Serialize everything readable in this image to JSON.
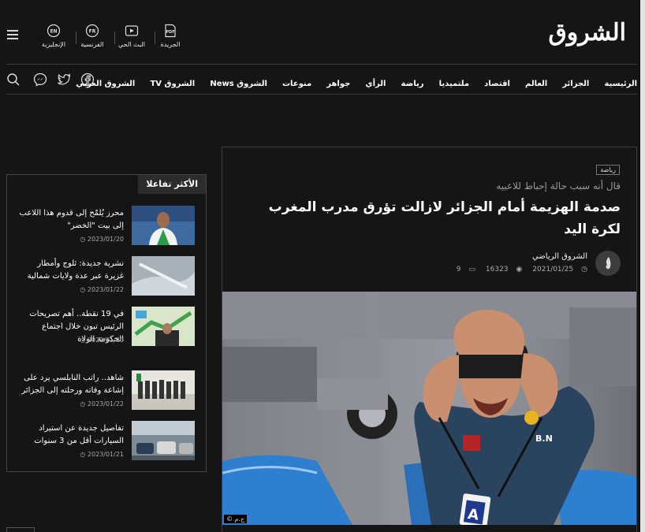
{
  "site": {
    "logo": "الشروق"
  },
  "quick_links": [
    {
      "label": "الجريدة",
      "icon": "pdf-icon"
    },
    {
      "label": "البث الحي",
      "icon": "play-icon"
    },
    {
      "label": "الفرنسية",
      "icon": "fr-icon"
    },
    {
      "label": "الإنجليزية",
      "icon": "en-icon"
    }
  ],
  "nav": {
    "items": [
      "الرئيسية",
      "الجزائر",
      "العالم",
      "اقتصاد",
      "ملتميديا",
      "رياضة",
      "الرأي",
      "جواهر",
      "منوعات",
      "الشروق News",
      "الشروق TV",
      "الشروق العربي"
    ]
  },
  "social_icons": [
    "facebook-icon",
    "twitter-icon",
    "messenger-icon",
    "search-icon"
  ],
  "article": {
    "category": "رياضة",
    "kicker": "قال أنه سبب حالة إحباط للاعبيه",
    "headline": "صدمة الهزيمة أمام الجزائر لازالت تؤرق مدرب المغرب لكرة اليد",
    "author": "الشروق الرياضي",
    "date": "2021/01/25",
    "views": "16323",
    "comments": "9",
    "photo_credit": "© ح.م",
    "badge_letters": "B.N",
    "tag_letter": "A"
  },
  "sidebar": {
    "title": "الأكثر تفاعلا",
    "items": [
      {
        "title": "محرز يُلمّح إلى قدوم هذا اللاعب إلى بيت \"الخضر\"",
        "date": "2023/01/20"
      },
      {
        "title": "نشرية جديدة: ثلوج وأمطار غزيرة عبر عدة ولايات شمالية",
        "date": "2023/01/22"
      },
      {
        "title": "في 19 نقطة.. أهم تصريحات الرئيس تبون خلال اجتماع الحكومة الولاة",
        "date": "2023/01/20"
      },
      {
        "title": "شاهد.. راتب النابلسي يرد على إشاعة وفاته ورحلته إلى الجزائر",
        "date": "2023/01/22"
      },
      {
        "title": "تفاصيل جديدة عن استيراد السيارات أقل من 3 سنوات",
        "date": "2023/01/21"
      }
    ]
  },
  "colors": {
    "background": "#151515",
    "card_border": "#3d3d3d",
    "shirt": "#2a4460"
  }
}
